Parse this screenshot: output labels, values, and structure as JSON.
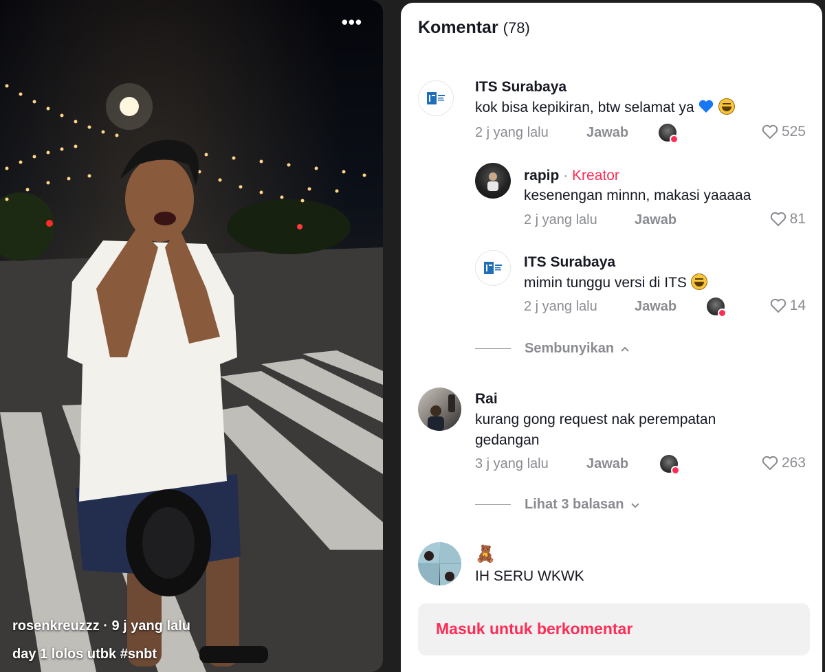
{
  "video": {
    "author": "rosenkreuzzz",
    "time": "9 j yang lalu",
    "description": "day 1 lolos utbk #snbt",
    "more_icon": "ellipsis-icon"
  },
  "comments_panel": {
    "title": "Komentar",
    "count": "(78)",
    "comments": [
      {
        "name": "ITS Surabaya",
        "text": "kok bisa kepikiran, btw selamat ya",
        "time": "2 j yang lalu",
        "reply": "Jawab",
        "likes": "525"
      },
      {
        "name": "rapip",
        "dot": "·",
        "creator_badge": "Kreator",
        "text": "kesenengan minnn, makasi yaaaaa",
        "time": "2 j yang lalu",
        "reply": "Jawab",
        "likes": "81"
      },
      {
        "name": "ITS Surabaya",
        "text": "mimin tunggu versi di ITS",
        "time": "2 j yang lalu",
        "reply": "Jawab",
        "likes": "14"
      },
      {
        "name": "Rai",
        "text_line1": "kurang gong request nak perempatan",
        "text_line2": "gedangan",
        "time": "3 j yang lalu",
        "reply": "Jawab",
        "likes": "263"
      },
      {
        "name": "🧸",
        "text": "IH SERU WKWK"
      }
    ],
    "hide_replies": "Sembunyikan",
    "view_replies": "Lihat 3 balasan",
    "login_prompt": "Masuk untuk berkomentar"
  },
  "colors": {
    "accent": "#fe2c55",
    "muted": "#8a8b91",
    "text": "#161823"
  }
}
